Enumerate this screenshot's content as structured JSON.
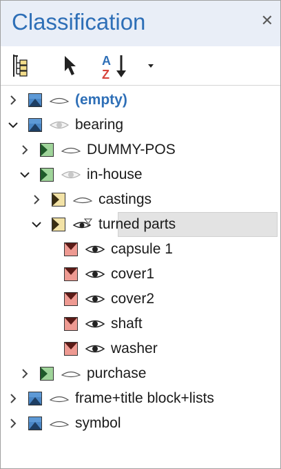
{
  "panel": {
    "title": "Classification",
    "close_glyph": "✕"
  },
  "toolbar": {
    "tree_icon": "tree-structure-icon",
    "select_icon": "cursor-arrow-icon",
    "sort_icon": "sort-az-icon",
    "dropdown_icon": "dropdown-caret-icon"
  },
  "tree": {
    "items": [
      {
        "label": "(empty)"
      },
      {
        "label": "bearing"
      },
      {
        "label": "DUMMY-POS"
      },
      {
        "label": "in-house"
      },
      {
        "label": "castings"
      },
      {
        "label": "turned parts"
      },
      {
        "label": "capsule 1"
      },
      {
        "label": "cover1"
      },
      {
        "label": "cover2"
      },
      {
        "label": "shaft"
      },
      {
        "label": "washer"
      },
      {
        "label": "purchase"
      },
      {
        "label": "frame+title block+lists"
      },
      {
        "label": "symbol"
      }
    ]
  },
  "colors": {
    "title": "#2e6fb7",
    "header_bg": "#e9eef7",
    "blue_folder": "#4a86c5",
    "green_folder": "#9fd49a",
    "yellow_folder": "#f2e2a6",
    "red_part": "#ee9a92"
  }
}
